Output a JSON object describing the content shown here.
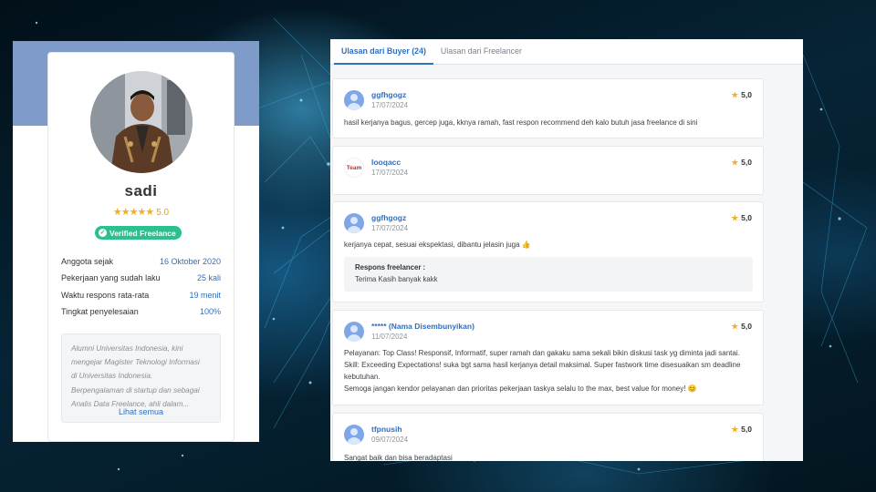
{
  "profile": {
    "name": "sadi",
    "stars": "★★★★★",
    "rating": "5.0",
    "verified_label": "Verified Freelance",
    "stats": [
      {
        "label": "Anggota sejak",
        "value": "16 Oktober 2020"
      },
      {
        "label": "Pekerjaan yang sudah laku",
        "value": "25 kali"
      },
      {
        "label": "Waktu respons rata-rata",
        "value": "19 menit"
      },
      {
        "label": "Tingkat penyelesaian",
        "value": "100%"
      }
    ],
    "about_lines": [
      "Alumni Universitas Indonesia, kini",
      "mengejar Magister Teknologi Informasi",
      "di Universitas Indonesia.",
      "Berpengalaman di startup dan sebagai",
      "Analis Data Freelance, ahli dalam..."
    ],
    "see_all_label": "Lihat semua"
  },
  "tabs": [
    {
      "label": "Ulasan dari Buyer (24)",
      "active": true
    },
    {
      "label": "Ulasan dari Freelancer",
      "active": false
    }
  ],
  "reviews": [
    {
      "name": "ggfhgogz",
      "date": "17/07/2024",
      "score": "5,0",
      "avatar": "user-placeholder",
      "text_lines": [
        "hasil kerjanya bagus, gercep juga, kknya ramah, fast respon recommend deh kalo butuh jasa freelance di sini"
      ]
    },
    {
      "name": "looqacc",
      "date": "17/07/2024",
      "score": "5,0",
      "avatar": "team-logo",
      "avatar_text": "Team",
      "text_lines": []
    },
    {
      "name": "ggfhgogz",
      "date": "17/07/2024",
      "score": "5,0",
      "avatar": "user-placeholder",
      "text_lines": [
        "kerjanya cepat, sesuai ekspektasi, dibantu jelasin juga 👍"
      ],
      "response": {
        "label": "Respons freelancer :",
        "text": "Terima Kasih banyak kakk"
      }
    },
    {
      "name": "***** (Nama Disembunyikan)",
      "date": "11/07/2024",
      "score": "5,0",
      "avatar": "user-placeholder",
      "text_lines": [
        "Pelayanan: Top Class! Responsif, Informatif, super ramah dan gakaku sama sekali bikin diskusi task yg diminta jadi santai.",
        "Skill: Exceeding Expectations! suka bgt sama hasil kerjanya detail maksimal. Super fastwork time disesuaikan sm deadline",
        "kebutuhan.",
        "Semoga jangan kendor pelayanan dan prioritas pekerjaan taskya selalu to the max, best value for money! 😊"
      ]
    },
    {
      "name": "tfpnusih",
      "date": "09/07/2024",
      "score": "5,0",
      "avatar": "user-placeholder",
      "text_lines": [
        "Sangat baik dan bisa beradaptasi"
      ]
    }
  ],
  "colors": {
    "accent": "#2f6fc0",
    "verified": "#2dbf8c",
    "star": "#f2b01e",
    "banner": "#7f9bc9"
  }
}
